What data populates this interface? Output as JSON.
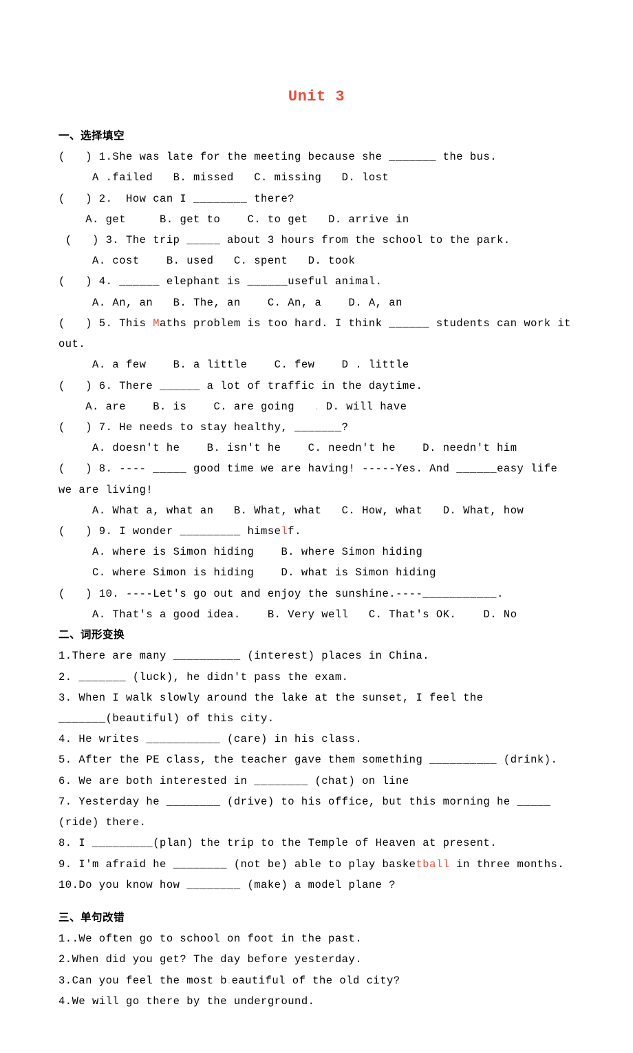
{
  "title": "Unit 3",
  "sections": {
    "s1": {
      "heading": "一、选择填空",
      "q1": {
        "stem_pre": "(   ) 1.She was late for the meeting because she _______ the bus.",
        "opts": "     A .failed   B. missed   C. missing   D. lost"
      },
      "q2": {
        "stem": "(   ) 2.  How can I ________ there?",
        "opts": "    A. get     B. get to    C. to get   D. arrive in"
      },
      "q3": {
        "stem": " (   ) 3. The trip _____ about 3 hours from the school to the park.",
        "opts": "     A. cost    B. used   C. spent   D. took"
      },
      "q4": {
        "stem": "(   ) 4. ______ elephant is ______useful animal.",
        "opts": "     A. An, an   B. The, an    C. An, a    D. A, an"
      },
      "q5": {
        "stem_pre": "(   ) 5. This ",
        "stem_mid": "M",
        "stem_post": "aths problem is too hard. I think ______ students can work it out.",
        "opts": "     A. a few    B. a little    C. few    D . little"
      },
      "q6": {
        "stem": "(   ) 6. There ______ a lot of traffic in the daytime.",
        "opts_pre": "    A. are    B. is    C. are going   ",
        "opts_dot": ".",
        "opts_post": " D. will have"
      },
      "q7": {
        "stem": "(   ) 7. He needs to stay healthy, _______?",
        "opts": "     A. doesn't he    B. isn't he    C. needn't he    D. needn't him"
      },
      "q8": {
        "stem": "(   ) 8. ---- _____ good time we are having! -----Yes. And ______easy life we are living!",
        "opts": "     A. What a, what an   B. What, what   C. How, what   D. What, how"
      },
      "q9": {
        "stem_pre": "(   ) 9. I wonder _________ himse",
        "stem_mid": "l",
        "stem_post": "f.",
        "opts1": "     A. where is Simon hiding    B. where Simon hiding",
        "opts2": "     C. where Simon is hiding    D. what is Simon hiding"
      },
      "q10": {
        "stem": "(   ) 10. ----Let's go out and enjoy the sunshine.----___________.",
        "opts": "     A. That's a good idea.    B. Very well   C. That's OK.    D. No"
      }
    },
    "s2": {
      "heading": "二、词形变换",
      "q1": "1.There are many __________ (interest) places in China.",
      "q2": "2. _______ (luck), he didn't pass the exam.",
      "q3": "3. When I walk slowly around the lake at the sunset, I feel the _______(beautiful) of this city.",
      "q4": "4. He writes ___________ (care) in his class.",
      "q5": "5. After the PE class, the teacher gave them something __________ (drink).",
      "q6": "6. We are both interested in ________ (chat) on line",
      "q7": "7. Yesterday he ________ (drive) to his office, but this morning he _____ (ride) there.",
      "q8": "8. I _________(plan) the trip to the Temple of Heaven at present.",
      "q9_pre": "9. I'm afraid he ________ (not be) able to play baske",
      "q9_mid": "tball",
      "q9_post": " in three months.",
      "q10": "10.Do you know how ________ (make) a model plane ?"
    },
    "s3": {
      "heading": "三、单句改错",
      "q1": "1..We often go to school on foot in the past.",
      "q2": "2.When did you get? The day before yesterday.",
      "q3_pre": "3.Can you feel the most b",
      "q3_post": "eautiful of the old city?",
      "q4": "4.We will go there by the underground."
    }
  }
}
